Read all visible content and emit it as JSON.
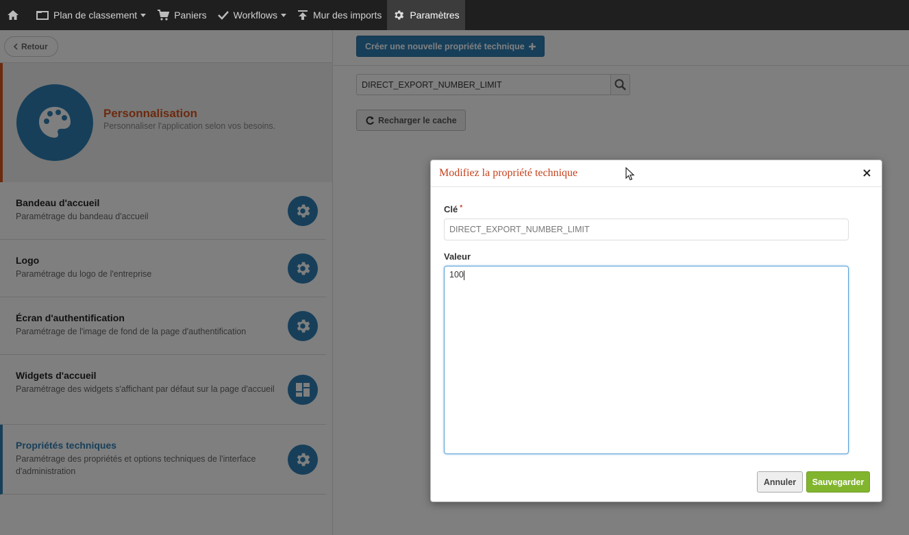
{
  "navbar": {
    "items": [
      {
        "label": "Plan de classement",
        "icon": "folder-icon",
        "dropdown": true
      },
      {
        "label": "Paniers",
        "icon": "cart-icon",
        "dropdown": false
      },
      {
        "label": "Workflows",
        "icon": "check-icon",
        "dropdown": true
      },
      {
        "label": "Mur des imports",
        "icon": "upload-icon",
        "dropdown": false
      },
      {
        "label": "Paramètres",
        "icon": "gear-icon",
        "dropdown": false,
        "active": true
      }
    ]
  },
  "sidebar": {
    "back_label": "Retour",
    "hero": {
      "title": "Personnalisation",
      "subtitle": "Personnaliser l'application selon vos besoins."
    },
    "items": [
      {
        "title": "Bandeau d'accueil",
        "desc": "Paramétrage du bandeau d'accueil",
        "icon": "gear-icon"
      },
      {
        "title": "Logo",
        "desc": "Paramétrage du logo de l'entreprise",
        "icon": "gear-icon"
      },
      {
        "title": "Écran d'authentification",
        "desc": "Paramétrage de l'image de fond de la page d'authentification",
        "icon": "gear-icon"
      },
      {
        "title": "Widgets d'accueil",
        "desc": "Paramétrage des widgets s'affichant par défaut sur la page d'accueil",
        "icon": "dashboard-icon"
      },
      {
        "title": "Propriétés techniques",
        "desc": "Paramétrage des propriétés et options techniques de l'interface d'administration",
        "icon": "gear-icon",
        "active": true
      }
    ]
  },
  "main": {
    "create_label": "Créer une nouvelle propriété technique",
    "search_value": "DIRECT_EXPORT_NUMBER_LIMIT",
    "reload_label": "Recharger le cache"
  },
  "modal": {
    "title": "Modifiez la propriété technique",
    "key_label": "Clé",
    "key_required": "*",
    "key_value": "DIRECT_EXPORT_NUMBER_LIMIT",
    "value_label": "Valeur",
    "value_value": "100",
    "cancel_label": "Annuler",
    "save_label": "Sauvegarder"
  },
  "colors": {
    "accent_blue": "#2f7fb5",
    "accent_orange": "#d9541e",
    "save_green": "#82b52e"
  }
}
